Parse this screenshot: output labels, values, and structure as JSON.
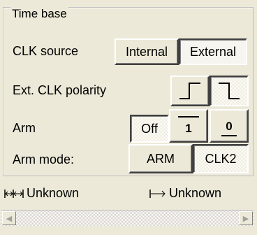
{
  "group": {
    "title": "Time base"
  },
  "clk_source": {
    "label": "CLK source",
    "options": [
      "Internal",
      "External"
    ],
    "selected": "External"
  },
  "ext_clk_polarity": {
    "label": "Ext. CLK polarity",
    "options": [
      "rising-edge-icon",
      "falling-edge-icon"
    ],
    "selected": "falling-edge-icon"
  },
  "arm": {
    "label": "Arm",
    "options": [
      "Off",
      "1",
      "0"
    ],
    "selected": "Off"
  },
  "arm_mode": {
    "label": "Arm mode:",
    "options": [
      "ARM",
      "CLK2"
    ],
    "selected": "CLK2"
  },
  "status": {
    "left": "Unknown",
    "right": "Unknown"
  }
}
